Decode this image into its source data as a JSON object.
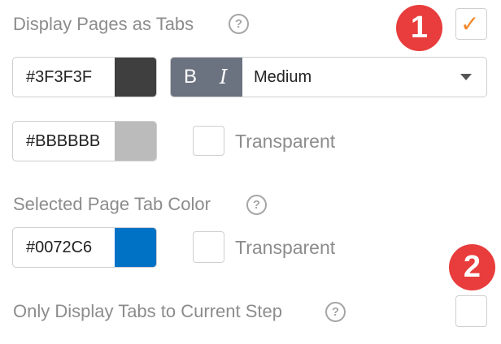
{
  "display_pages_as_tabs": {
    "label": "Display Pages as Tabs",
    "help_icon": "?",
    "checked": true,
    "check_glyph": "✓",
    "check_color": "#f0882c"
  },
  "tab_text": {
    "hex": "#3F3F3F",
    "swatch_color": "#3F3F3F",
    "bold_label": "B",
    "italic_label": "I",
    "size_value": "Medium"
  },
  "tab_background": {
    "hex": "#BBBBBB",
    "swatch_color": "#BBBBBB",
    "transparent_label": "Transparent",
    "transparent_checked": false
  },
  "selected_tab_color": {
    "label": "Selected Page Tab Color",
    "help_icon": "?",
    "hex": "#0072C6",
    "swatch_color": "#0072C6",
    "transparent_label": "Transparent",
    "transparent_checked": false
  },
  "only_display_tabs": {
    "label": "Only Display Tabs to Current Step",
    "help_icon": "?",
    "checked": false
  },
  "callouts": {
    "badge_1": "1",
    "badge_2": "2",
    "color": "#e93c3c"
  }
}
